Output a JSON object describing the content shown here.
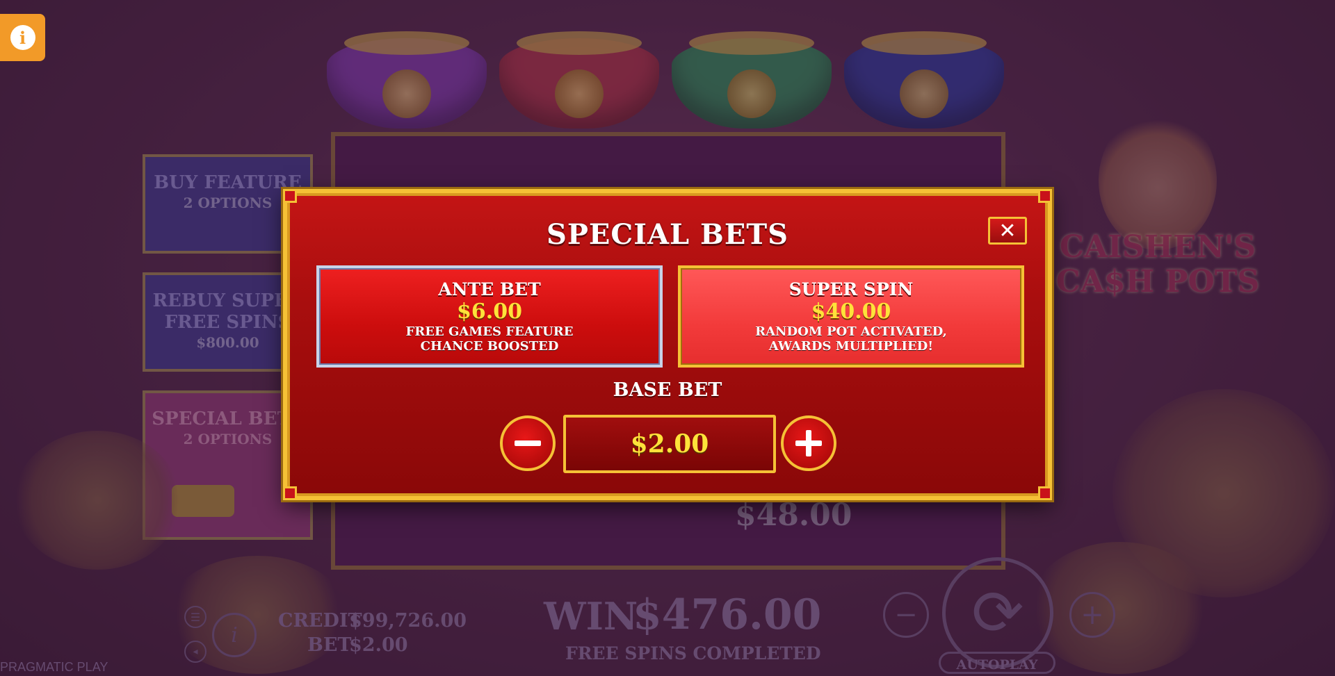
{
  "info_button": {
    "icon": "info-icon",
    "glyph": "i"
  },
  "background": {
    "side_buttons": [
      {
        "title": "BUY FEATURE",
        "subtitle": "2 OPTIONS"
      },
      {
        "title": "REBUY SUPER FREE SPINS",
        "subtitle": "$800.00"
      },
      {
        "title": "SPECIAL BETS",
        "subtitle": "2 OPTIONS"
      }
    ],
    "logo_line1": "CAISHEN'S",
    "logo_line2": "CA$H POTS",
    "reel_amount": "$48.00",
    "credit_label": "CREDIT",
    "credit_value": "$99,726.00",
    "bet_label": "BET",
    "bet_value": "$2.00",
    "win_label": "WIN",
    "win_value": "$476.00",
    "status": "FREE SPINS COMPLETED",
    "autoplay_label": "AUTOPLAY",
    "provider": "PRAGMATIC PLAY"
  },
  "modal": {
    "title": "SPECIAL BETS",
    "close_glyph": "✕",
    "ante": {
      "name": "ANTE BET",
      "price": "$6.00",
      "desc_line1": "FREE GAMES FEATURE",
      "desc_line2": "CHANCE BOOSTED"
    },
    "super": {
      "name": "SUPER SPIN",
      "price": "$40.00",
      "desc_line1": "RANDOM POT ACTIVATED,",
      "desc_line2": "AWARDS MULTIPLIED!"
    },
    "base_bet_label": "BASE BET",
    "base_bet_value": "$2.00"
  },
  "colors": {
    "gold": "#f5c136",
    "red": "#c41515",
    "price_yellow": "#ffe23a",
    "info_orange": "#f29a28"
  }
}
